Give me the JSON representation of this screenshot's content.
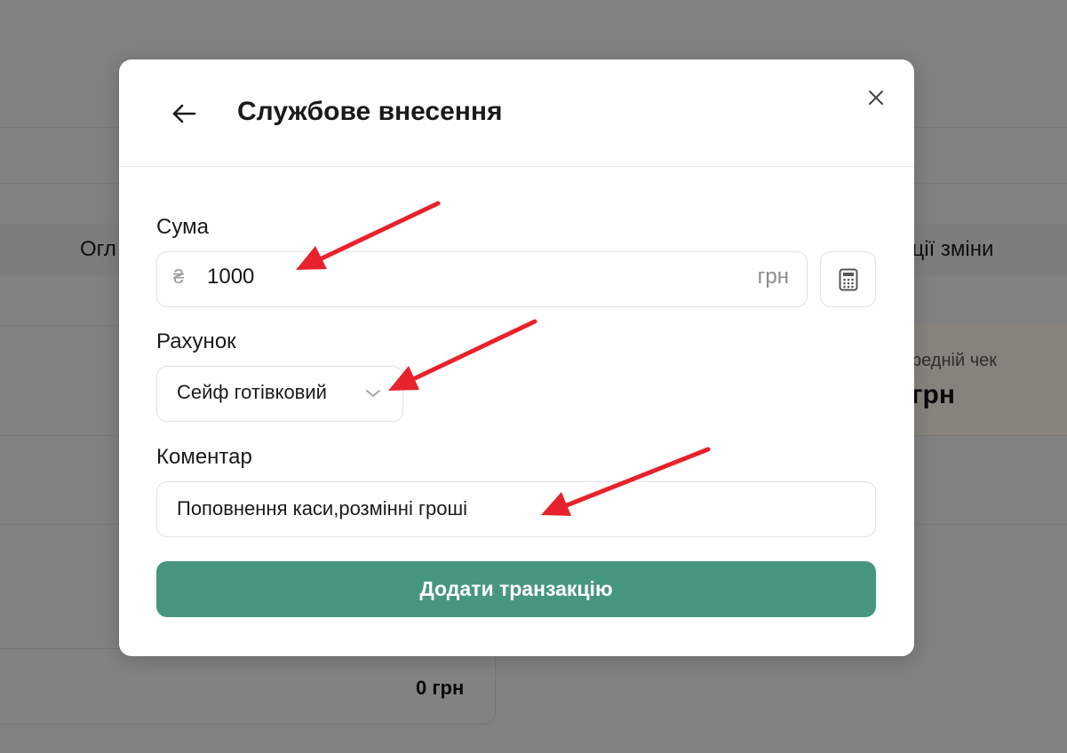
{
  "background": {
    "tab_left": "Огл",
    "tab_right": "кції зміни",
    "card_label": "редній чек",
    "card_value": "грн",
    "panel_value": "0 грн"
  },
  "modal": {
    "title": "Службове внесення",
    "back_icon": "arrow-left-icon",
    "close_icon": "close-icon"
  },
  "amount": {
    "label": "Сума",
    "currency_sign": "₴",
    "value": "1000",
    "unit": "грн",
    "calculator_icon": "calculator-icon"
  },
  "account": {
    "label": "Рахунок",
    "selected": "Сейф готівковий"
  },
  "comment": {
    "label": "Коментар",
    "value": "Поповнення каси,розмінні гроші"
  },
  "submit": {
    "label": "Додати транзакцію"
  },
  "colors": {
    "accent": "#47977f",
    "annotation": "#e8222c"
  }
}
